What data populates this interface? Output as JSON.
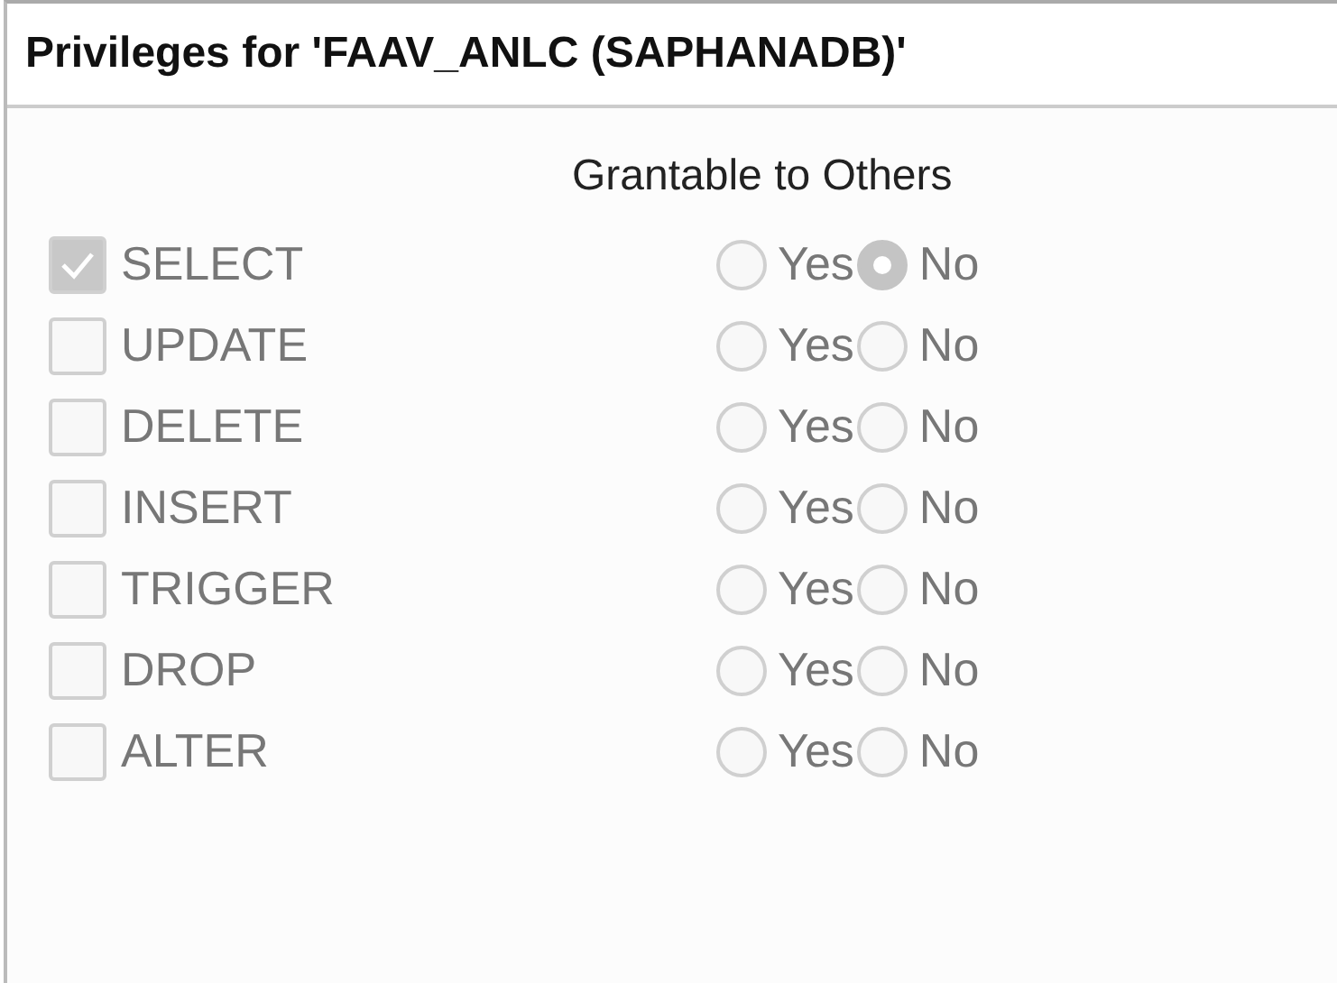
{
  "window": {
    "title": "Privileges for 'FAAV_ANLC (SAPHANADB)'"
  },
  "grant_header": "Grantable to Others",
  "privileges": [
    {
      "name": "SELECT",
      "checked": true,
      "disabled": true,
      "options": [
        {
          "label": "Yes",
          "selected": false
        },
        {
          "label": "No",
          "selected": true
        }
      ]
    },
    {
      "name": "UPDATE",
      "checked": false,
      "disabled": true,
      "options": [
        {
          "label": "Yes",
          "selected": false
        },
        {
          "label": "No",
          "selected": false
        }
      ]
    },
    {
      "name": "DELETE",
      "checked": false,
      "disabled": true,
      "options": [
        {
          "label": "Yes",
          "selected": false
        },
        {
          "label": "No",
          "selected": false
        }
      ]
    },
    {
      "name": "INSERT",
      "checked": false,
      "disabled": true,
      "options": [
        {
          "label": "Yes",
          "selected": false
        },
        {
          "label": "No",
          "selected": false
        }
      ]
    },
    {
      "name": "TRIGGER",
      "checked": false,
      "disabled": true,
      "options": [
        {
          "label": "Yes",
          "selected": false
        },
        {
          "label": "No",
          "selected": false
        }
      ]
    },
    {
      "name": "DROP",
      "checked": false,
      "disabled": true,
      "options": [
        {
          "label": "Yes",
          "selected": false
        },
        {
          "label": "No",
          "selected": false
        }
      ]
    },
    {
      "name": "ALTER",
      "checked": false,
      "disabled": true,
      "options": [
        {
          "label": "Yes",
          "selected": false
        },
        {
          "label": "No",
          "selected": false
        }
      ]
    }
  ]
}
